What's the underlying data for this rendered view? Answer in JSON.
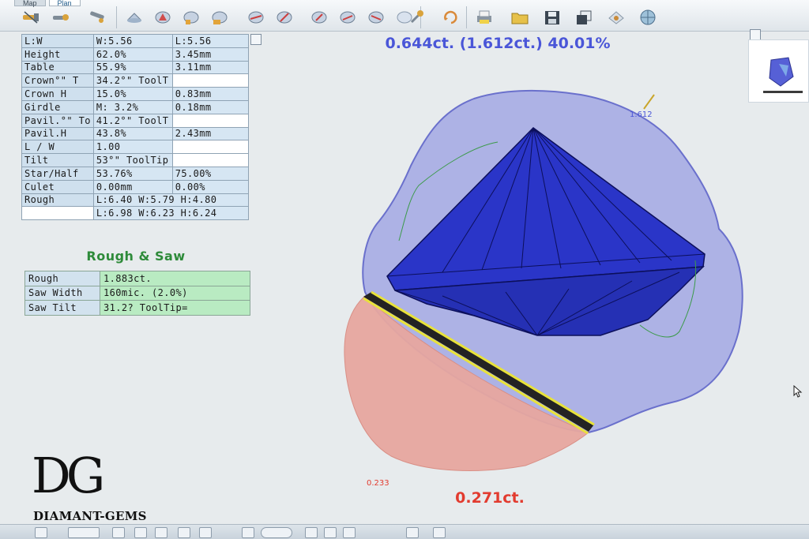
{
  "toolbar": {
    "tabs": [
      "Map",
      "Plan"
    ],
    "tools": [
      "laser-saw-icon",
      "laser-saw-icon",
      "laser-saw-icon",
      "diamond-shape-icon",
      "diamond-shape-icon",
      "diamond-shape-icon",
      "diamond-shape-icon",
      "diamond-shape-icon",
      "diamond-shape-icon",
      "diamond-shape-icon",
      "diamond-shape-icon",
      "diamond-shape-icon",
      "wrench-icon",
      "rotate-icon",
      "printer-icon",
      "folder-icon",
      "save-icon",
      "copy-icon",
      "eye-icon",
      "globe-icon"
    ]
  },
  "params": {
    "rows": [
      [
        "L:W",
        "W:5.56",
        "L:5.56"
      ],
      [
        "Height",
        "62.0%",
        "3.45mm"
      ],
      [
        "Table",
        "55.9%",
        "3.11mm"
      ],
      [
        "Crown°\" T",
        "34.2°\" ToolT",
        ""
      ],
      [
        "Crown H",
        "15.0%",
        "0.83mm"
      ],
      [
        "Girdle",
        "M: 3.2%",
        "0.18mm"
      ],
      [
        "Pavil.°\" To",
        "41.2°\" ToolT",
        ""
      ],
      [
        "Pavil.H",
        "43.8%",
        "2.43mm"
      ],
      [
        "L / W",
        "1.00",
        ""
      ],
      [
        "Tilt",
        "53°\" ToolTip",
        ""
      ],
      [
        "Star/Half",
        "53.76%",
        "75.00%"
      ],
      [
        "Culet",
        "0.00mm",
        "0.00%"
      ],
      [
        "Rough",
        "L:6.40 W:5.79 H:4.80",
        ""
      ],
      [
        "",
        "L:6.98 W:6.23 H:6.24",
        ""
      ]
    ]
  },
  "rough_saw": {
    "title": "Rough & Saw",
    "rows": [
      [
        "Rough",
        "1.883ct."
      ],
      [
        "Saw Width",
        "160mic. (2.0%)"
      ],
      [
        "Saw Tilt",
        "31.2? ToolTip="
      ]
    ]
  },
  "stats": {
    "top": "0.644ct. (1.612ct.) 40.01%",
    "top_small": "1.612",
    "bottom": "0.271ct.",
    "bottom_small": "0.233"
  },
  "logo": {
    "mark": "DG",
    "text": "DIAMANT-GEMS"
  },
  "colors": {
    "rough_blue": "#8e93e0",
    "stone_blue": "#2a35c8",
    "rough_red": "#e7a79f",
    "saw_yellow": "#e8e23a",
    "stat_blue": "#4a56d8",
    "stat_red": "#e23b2f",
    "title_green": "#2e8b3a"
  }
}
